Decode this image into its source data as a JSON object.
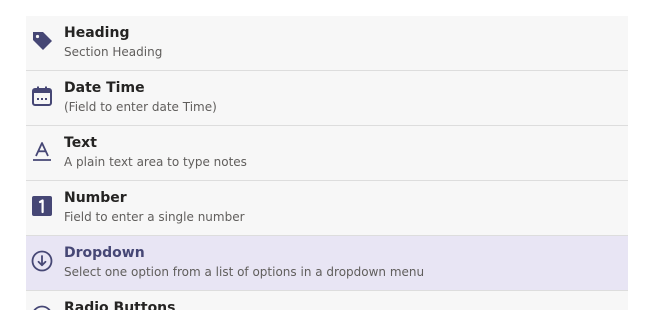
{
  "colors": {
    "icon": "#464775",
    "selected_bg": "#e8e5f4",
    "row_bg": "#f7f7f7"
  },
  "fields": [
    {
      "icon": "tag-icon",
      "title": "Heading",
      "description": "Section Heading"
    },
    {
      "icon": "calendar-icon",
      "title": "Date Time",
      "description": "(Field to enter date Time)"
    },
    {
      "icon": "text-icon",
      "title": "Text",
      "description": "A plain text area to type notes"
    },
    {
      "icon": "number-icon",
      "title": "Number",
      "description": "Field to enter a single number"
    },
    {
      "icon": "dropdown-icon",
      "title": "Dropdown",
      "description": "Select one option from a list of options in a dropdown menu",
      "selected": true
    },
    {
      "icon": "radio-icon",
      "title": "Radio Buttons",
      "description": ""
    }
  ]
}
